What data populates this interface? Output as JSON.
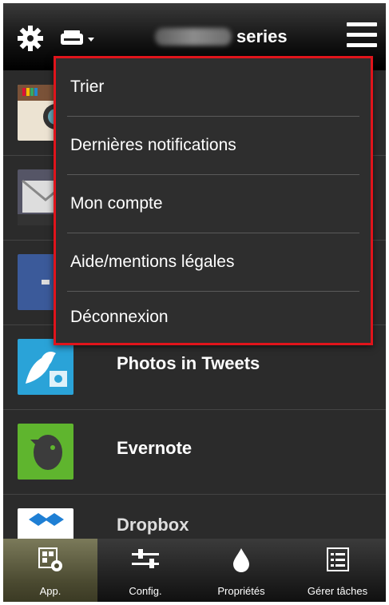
{
  "header": {
    "series_label": "series",
    "model_name_hidden": "MB5300"
  },
  "menu": {
    "items": [
      {
        "label": "Trier"
      },
      {
        "label": "Dernières notifications"
      },
      {
        "label": "Mon compte"
      },
      {
        "label": "Aide/mentions légales"
      },
      {
        "label": "Déconnexion"
      }
    ]
  },
  "apps": [
    {
      "label": "",
      "icon": "instagram-icon"
    },
    {
      "label": "",
      "icon": "mail-icon"
    },
    {
      "label": "",
      "icon": "facebook-icon"
    },
    {
      "label": "Photos in Tweets",
      "icon": "twitter-photo-icon"
    },
    {
      "label": "Evernote",
      "icon": "evernote-icon"
    },
    {
      "label": "Dropbox",
      "icon": "dropbox-icon"
    }
  ],
  "bottom_nav": {
    "items": [
      {
        "label": "App.",
        "icon": "apps-icon",
        "active": true
      },
      {
        "label": "Config.",
        "icon": "settings-sliders-icon"
      },
      {
        "label": "Propriétés",
        "icon": "ink-drop-icon"
      },
      {
        "label": "Gérer tâches",
        "icon": "task-list-icon"
      }
    ]
  },
  "colors": {
    "menu_border": "#e0141b",
    "active_tab": "#6b6a4a"
  }
}
